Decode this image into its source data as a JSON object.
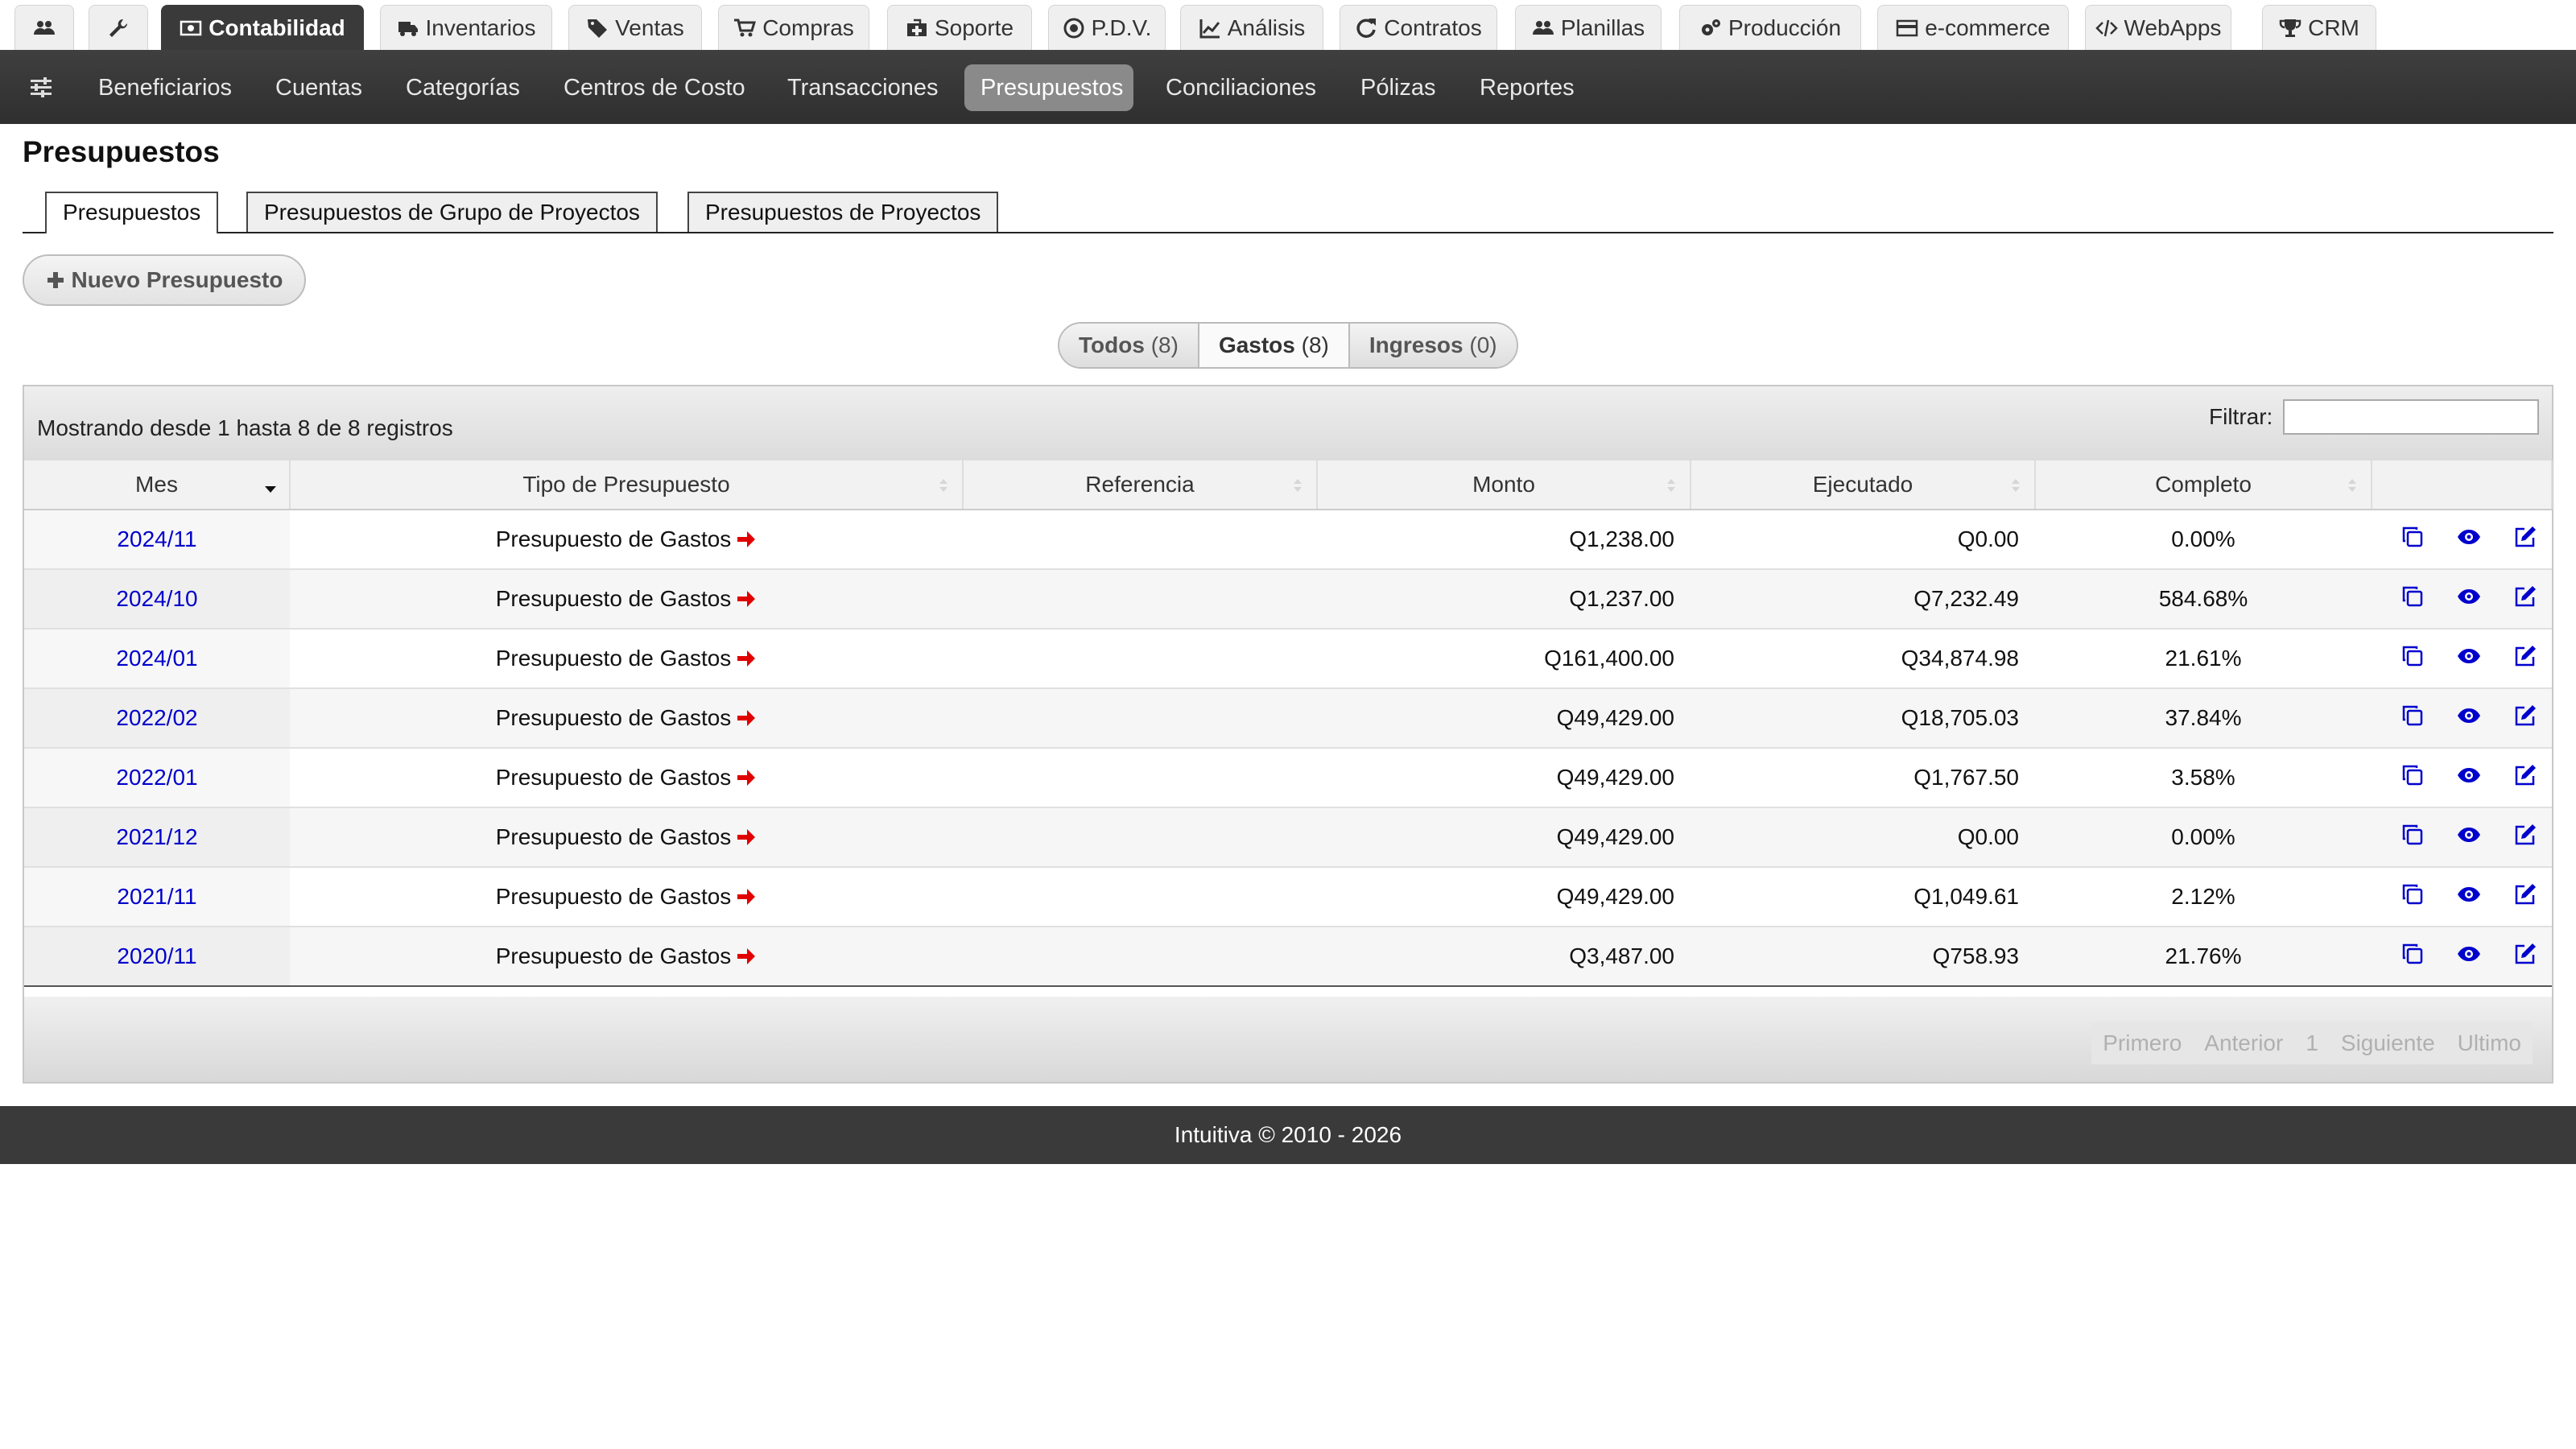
{
  "top_tabs": [
    {
      "label": "",
      "icon": "users-icon"
    },
    {
      "label": "",
      "icon": "wrench-icon"
    },
    {
      "label": "Contabilidad",
      "icon": "money-icon"
    },
    {
      "label": "Inventarios",
      "icon": "truck-icon"
    },
    {
      "label": "Ventas",
      "icon": "tags-icon"
    },
    {
      "label": "Compras",
      "icon": "cart-icon"
    },
    {
      "label": "Soporte",
      "icon": "medkit-icon"
    },
    {
      "label": "P.D.V.",
      "icon": "dot-circle-icon"
    },
    {
      "label": "Análisis",
      "icon": "line-chart-icon"
    },
    {
      "label": "Contratos",
      "icon": "refresh-icon"
    },
    {
      "label": "Planillas",
      "icon": "users-icon"
    },
    {
      "label": "Producción",
      "icon": "gears-icon"
    },
    {
      "label": "e-commerce",
      "icon": "credit-card-icon"
    },
    {
      "label": "WebApps",
      "icon": "code-icon"
    },
    {
      "label": "CRM",
      "icon": "trophy-icon"
    }
  ],
  "sub_nav": [
    "Beneficiarios",
    "Cuentas",
    "Categorías",
    "Centros de Costo",
    "Transacciones",
    "Presupuestos",
    "Conciliaciones",
    "Pólizas",
    "Reportes"
  ],
  "page": {
    "title": "Presupuestos"
  },
  "sub_tabs": [
    "Presupuestos",
    "Presupuestos de Grupo de Proyectos",
    "Presupuestos de Proyectos"
  ],
  "new_button": "Nuevo Presupuesto",
  "filters": [
    {
      "label": "Todos",
      "count": "(8)"
    },
    {
      "label": "Gastos",
      "count": "(8)"
    },
    {
      "label": "Ingresos",
      "count": "(0)"
    }
  ],
  "table": {
    "info": "Mostrando desde 1 hasta 8 de 8 registros",
    "filter_label": "Filtrar:",
    "columns": [
      "Mes",
      "Tipo de Presupuesto",
      "Referencia",
      "Monto",
      "Ejecutado",
      "Completo"
    ],
    "rows": [
      {
        "mes": "2024/11",
        "tipo": "Presupuesto de Gastos",
        "referencia": "",
        "monto": "Q1,238.00",
        "ejecutado": "Q0.00",
        "completo": "0.00%"
      },
      {
        "mes": "2024/10",
        "tipo": "Presupuesto de Gastos",
        "referencia": "",
        "monto": "Q1,237.00",
        "ejecutado": "Q7,232.49",
        "completo": "584.68%"
      },
      {
        "mes": "2024/01",
        "tipo": "Presupuesto de Gastos",
        "referencia": "",
        "monto": "Q161,400.00",
        "ejecutado": "Q34,874.98",
        "completo": "21.61%"
      },
      {
        "mes": "2022/02",
        "tipo": "Presupuesto de Gastos",
        "referencia": "",
        "monto": "Q49,429.00",
        "ejecutado": "Q18,705.03",
        "completo": "37.84%"
      },
      {
        "mes": "2022/01",
        "tipo": "Presupuesto de Gastos",
        "referencia": "",
        "monto": "Q49,429.00",
        "ejecutado": "Q1,767.50",
        "completo": "3.58%"
      },
      {
        "mes": "2021/12",
        "tipo": "Presupuesto de Gastos",
        "referencia": "",
        "monto": "Q49,429.00",
        "ejecutado": "Q0.00",
        "completo": "0.00%"
      },
      {
        "mes": "2021/11",
        "tipo": "Presupuesto de Gastos",
        "referencia": "",
        "monto": "Q49,429.00",
        "ejecutado": "Q1,049.61",
        "completo": "2.12%"
      },
      {
        "mes": "2020/11",
        "tipo": "Presupuesto de Gastos",
        "referencia": "",
        "monto": "Q3,487.00",
        "ejecutado": "Q758.93",
        "completo": "21.76%"
      }
    ],
    "pagination": [
      "Primero",
      "Anterior",
      "1",
      "Siguiente",
      "Ultimo"
    ]
  },
  "footer": "Intuitiva © 2010 - 2026",
  "colors": {
    "accent_link": "#0000cc",
    "arrow": "#e00000",
    "nav_bg": "#333333",
    "active_tab": "#3a3a3a"
  }
}
